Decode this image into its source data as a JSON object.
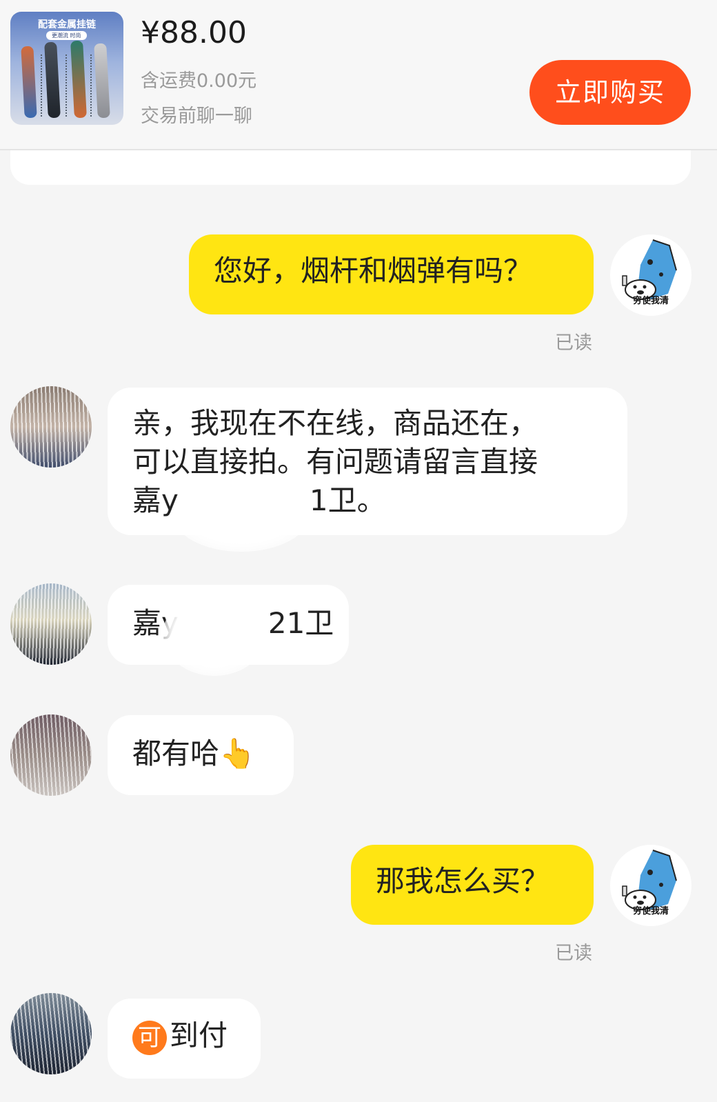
{
  "product": {
    "thumb_banner": "配套金属挂链",
    "thumb_tag": "更潮流 时尚",
    "price": "¥88.00",
    "shipping": "含运费0.00元",
    "chat_hint": "交易前聊一聊",
    "buy_label": "立即购买"
  },
  "avatars": {
    "me_caption": "穷使我清"
  },
  "messages": {
    "m1": {
      "sender": "me",
      "text": "您好，烟杆和烟弹有吗？",
      "status": "已读"
    },
    "m2": {
      "sender": "them",
      "line1": "亲，我现在不在线，商品还在，",
      "line2": "可以直接拍。有问题请留言直接",
      "line3": "嘉y",
      "line3_tail": "1卫。"
    },
    "m3": {
      "sender": "them",
      "prefix": "嘉y",
      "suffix": "21卫"
    },
    "m4": {
      "sender": "them",
      "text": "都有哈",
      "emoji": "👆"
    },
    "m5": {
      "sender": "me",
      "text": "那我怎么买？",
      "status": "已读"
    },
    "m6": {
      "sender": "them",
      "badge": "可",
      "text": "到付"
    }
  },
  "colors": {
    "buy_button": "#ff4e1c",
    "my_bubble": "#ffe512",
    "their_bubble": "#ffffff",
    "background": "#f5f5f5"
  }
}
